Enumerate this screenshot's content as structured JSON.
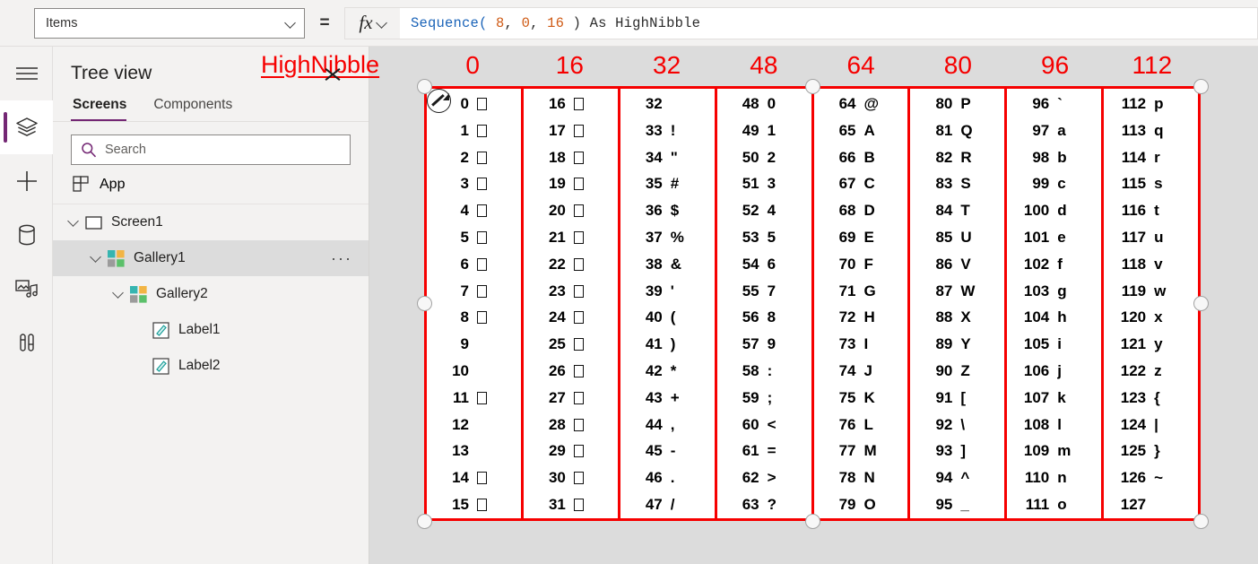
{
  "topbar": {
    "property_selected": "Items",
    "equals_sign": "=",
    "fx_label": "fx",
    "formula_tokens": [
      {
        "t": "Sequence(",
        "c": "fn"
      },
      {
        "t": " ",
        "c": "pl"
      },
      {
        "t": "8",
        "c": "num"
      },
      {
        "t": ", ",
        "c": "pl"
      },
      {
        "t": "0",
        "c": "num"
      },
      {
        "t": ", ",
        "c": "pl"
      },
      {
        "t": "16",
        "c": "num"
      },
      {
        "t": " ) As HighNibble",
        "c": "pl"
      }
    ],
    "formula_plain": "Sequence( 8, 0, 16 ) As HighNibble"
  },
  "rail": {
    "items": [
      {
        "name": "hamburger-menu-icon",
        "active": false
      },
      {
        "name": "tree-view-icon",
        "active": true
      },
      {
        "name": "insert-icon",
        "active": false
      },
      {
        "name": "data-icon",
        "active": false
      },
      {
        "name": "media-icon",
        "active": false
      },
      {
        "name": "advanced-tools-icon",
        "active": false
      }
    ]
  },
  "tree": {
    "title": "Tree view",
    "tabs": [
      {
        "label": "Screens",
        "selected": true
      },
      {
        "label": "Components",
        "selected": false
      }
    ],
    "search": {
      "placeholder": "Search",
      "value": ""
    },
    "app_label": "App",
    "nodes": [
      {
        "label": "Screen1",
        "icon": "screen-icon",
        "depth": 0,
        "expanded": true,
        "selected": false,
        "menu": false
      },
      {
        "label": "Gallery1",
        "icon": "gallery-icon",
        "depth": 1,
        "expanded": true,
        "selected": true,
        "menu": true,
        "menu_label": "···"
      },
      {
        "label": "Gallery2",
        "icon": "gallery-icon",
        "depth": 2,
        "expanded": true,
        "selected": false,
        "menu": false
      },
      {
        "label": "Label1",
        "icon": "label-icon",
        "depth": 3,
        "expanded": false,
        "selected": false,
        "menu": false
      },
      {
        "label": "Label2",
        "icon": "label-icon",
        "depth": 3,
        "expanded": false,
        "selected": false,
        "menu": false
      }
    ]
  },
  "canvas": {
    "overlay_label": "HighNibble",
    "accent_red": "#f60000",
    "column_headers": [
      "0",
      "16",
      "32",
      "48",
      "64",
      "80",
      "96",
      "112"
    ],
    "columns": [
      {
        "rows": [
          {
            "num": "0",
            "char": "",
            "box": true
          },
          {
            "num": "1",
            "char": "",
            "box": true
          },
          {
            "num": "2",
            "char": "",
            "box": true
          },
          {
            "num": "3",
            "char": "",
            "box": true
          },
          {
            "num": "4",
            "char": "",
            "box": true
          },
          {
            "num": "5",
            "char": "",
            "box": true
          },
          {
            "num": "6",
            "char": "",
            "box": true
          },
          {
            "num": "7",
            "char": "",
            "box": true
          },
          {
            "num": "8",
            "char": "",
            "box": true
          },
          {
            "num": "9",
            "char": "",
            "box": false
          },
          {
            "num": "10",
            "char": "",
            "box": false
          },
          {
            "num": "11",
            "char": "",
            "box": true
          },
          {
            "num": "12",
            "char": "",
            "box": false
          },
          {
            "num": "13",
            "char": "",
            "box": false
          },
          {
            "num": "14",
            "char": "",
            "box": true
          },
          {
            "num": "15",
            "char": "",
            "box": true
          }
        ]
      },
      {
        "rows": [
          {
            "num": "16",
            "char": "",
            "box": true
          },
          {
            "num": "17",
            "char": "",
            "box": true
          },
          {
            "num": "18",
            "char": "",
            "box": true
          },
          {
            "num": "19",
            "char": "",
            "box": true
          },
          {
            "num": "20",
            "char": "",
            "box": true
          },
          {
            "num": "21",
            "char": "",
            "box": true
          },
          {
            "num": "22",
            "char": "",
            "box": true
          },
          {
            "num": "23",
            "char": "",
            "box": true
          },
          {
            "num": "24",
            "char": "",
            "box": true
          },
          {
            "num": "25",
            "char": "",
            "box": true
          },
          {
            "num": "26",
            "char": "",
            "box": true
          },
          {
            "num": "27",
            "char": "",
            "box": true
          },
          {
            "num": "28",
            "char": "",
            "box": true
          },
          {
            "num": "29",
            "char": "",
            "box": true
          },
          {
            "num": "30",
            "char": "",
            "box": true
          },
          {
            "num": "31",
            "char": "",
            "box": true
          }
        ]
      },
      {
        "rows": [
          {
            "num": "32",
            "char": "",
            "box": false
          },
          {
            "num": "33",
            "char": "!",
            "box": false
          },
          {
            "num": "34",
            "char": "\"",
            "box": false
          },
          {
            "num": "35",
            "char": "#",
            "box": false
          },
          {
            "num": "36",
            "char": "$",
            "box": false
          },
          {
            "num": "37",
            "char": "%",
            "box": false
          },
          {
            "num": "38",
            "char": "&",
            "box": false
          },
          {
            "num": "39",
            "char": "'",
            "box": false
          },
          {
            "num": "40",
            "char": "(",
            "box": false
          },
          {
            "num": "41",
            "char": ")",
            "box": false
          },
          {
            "num": "42",
            "char": "*",
            "box": false
          },
          {
            "num": "43",
            "char": "+",
            "box": false
          },
          {
            "num": "44",
            "char": ",",
            "box": false
          },
          {
            "num": "45",
            "char": "-",
            "box": false
          },
          {
            "num": "46",
            "char": ".",
            "box": false
          },
          {
            "num": "47",
            "char": "/",
            "box": false
          }
        ]
      },
      {
        "rows": [
          {
            "num": "48",
            "char": "0",
            "box": false
          },
          {
            "num": "49",
            "char": "1",
            "box": false
          },
          {
            "num": "50",
            "char": "2",
            "box": false
          },
          {
            "num": "51",
            "char": "3",
            "box": false
          },
          {
            "num": "52",
            "char": "4",
            "box": false
          },
          {
            "num": "53",
            "char": "5",
            "box": false
          },
          {
            "num": "54",
            "char": "6",
            "box": false
          },
          {
            "num": "55",
            "char": "7",
            "box": false
          },
          {
            "num": "56",
            "char": "8",
            "box": false
          },
          {
            "num": "57",
            "char": "9",
            "box": false
          },
          {
            "num": "58",
            "char": ":",
            "box": false
          },
          {
            "num": "59",
            "char": ";",
            "box": false
          },
          {
            "num": "60",
            "char": "<",
            "box": false
          },
          {
            "num": "61",
            "char": "=",
            "box": false
          },
          {
            "num": "62",
            "char": ">",
            "box": false
          },
          {
            "num": "63",
            "char": "?",
            "box": false
          }
        ]
      },
      {
        "rows": [
          {
            "num": "64",
            "char": "@",
            "box": false
          },
          {
            "num": "65",
            "char": "A",
            "box": false
          },
          {
            "num": "66",
            "char": "B",
            "box": false
          },
          {
            "num": "67",
            "char": "C",
            "box": false
          },
          {
            "num": "68",
            "char": "D",
            "box": false
          },
          {
            "num": "69",
            "char": "E",
            "box": false
          },
          {
            "num": "70",
            "char": "F",
            "box": false
          },
          {
            "num": "71",
            "char": "G",
            "box": false
          },
          {
            "num": "72",
            "char": "H",
            "box": false
          },
          {
            "num": "73",
            "char": "I",
            "box": false
          },
          {
            "num": "74",
            "char": "J",
            "box": false
          },
          {
            "num": "75",
            "char": "K",
            "box": false
          },
          {
            "num": "76",
            "char": "L",
            "box": false
          },
          {
            "num": "77",
            "char": "M",
            "box": false
          },
          {
            "num": "78",
            "char": "N",
            "box": false
          },
          {
            "num": "79",
            "char": "O",
            "box": false
          }
        ]
      },
      {
        "rows": [
          {
            "num": "80",
            "char": "P",
            "box": false
          },
          {
            "num": "81",
            "char": "Q",
            "box": false
          },
          {
            "num": "82",
            "char": "R",
            "box": false
          },
          {
            "num": "83",
            "char": "S",
            "box": false
          },
          {
            "num": "84",
            "char": "T",
            "box": false
          },
          {
            "num": "85",
            "char": "U",
            "box": false
          },
          {
            "num": "86",
            "char": "V",
            "box": false
          },
          {
            "num": "87",
            "char": "W",
            "box": false
          },
          {
            "num": "88",
            "char": "X",
            "box": false
          },
          {
            "num": "89",
            "char": "Y",
            "box": false
          },
          {
            "num": "90",
            "char": "Z",
            "box": false
          },
          {
            "num": "91",
            "char": "[",
            "box": false
          },
          {
            "num": "92",
            "char": "\\",
            "box": false
          },
          {
            "num": "93",
            "char": "]",
            "box": false
          },
          {
            "num": "94",
            "char": "^",
            "box": false
          },
          {
            "num": "95",
            "char": "_",
            "box": false
          }
        ]
      },
      {
        "rows": [
          {
            "num": "96",
            "char": "`",
            "box": false
          },
          {
            "num": "97",
            "char": "a",
            "box": false
          },
          {
            "num": "98",
            "char": "b",
            "box": false
          },
          {
            "num": "99",
            "char": "c",
            "box": false
          },
          {
            "num": "100",
            "char": "d",
            "box": false
          },
          {
            "num": "101",
            "char": "e",
            "box": false
          },
          {
            "num": "102",
            "char": "f",
            "box": false
          },
          {
            "num": "103",
            "char": "g",
            "box": false
          },
          {
            "num": "104",
            "char": "h",
            "box": false
          },
          {
            "num": "105",
            "char": "i",
            "box": false
          },
          {
            "num": "106",
            "char": "j",
            "box": false
          },
          {
            "num": "107",
            "char": "k",
            "box": false
          },
          {
            "num": "108",
            "char": "l",
            "box": false
          },
          {
            "num": "109",
            "char": "m",
            "box": false
          },
          {
            "num": "110",
            "char": "n",
            "box": false
          },
          {
            "num": "111",
            "char": "o",
            "box": false
          }
        ]
      },
      {
        "rows": [
          {
            "num": "112",
            "char": "p",
            "box": false
          },
          {
            "num": "113",
            "char": "q",
            "box": false
          },
          {
            "num": "114",
            "char": "r",
            "box": false
          },
          {
            "num": "115",
            "char": "s",
            "box": false
          },
          {
            "num": "116",
            "char": "t",
            "box": false
          },
          {
            "num": "117",
            "char": "u",
            "box": false
          },
          {
            "num": "118",
            "char": "v",
            "box": false
          },
          {
            "num": "119",
            "char": "w",
            "box": false
          },
          {
            "num": "120",
            "char": "x",
            "box": false
          },
          {
            "num": "121",
            "char": "y",
            "box": false
          },
          {
            "num": "122",
            "char": "z",
            "box": false
          },
          {
            "num": "123",
            "char": "{",
            "box": false
          },
          {
            "num": "124",
            "char": "|",
            "box": false
          },
          {
            "num": "125",
            "char": "}",
            "box": false
          },
          {
            "num": "126",
            "char": "~",
            "box": false
          },
          {
            "num": "127",
            "char": "",
            "box": false
          }
        ]
      }
    ]
  }
}
